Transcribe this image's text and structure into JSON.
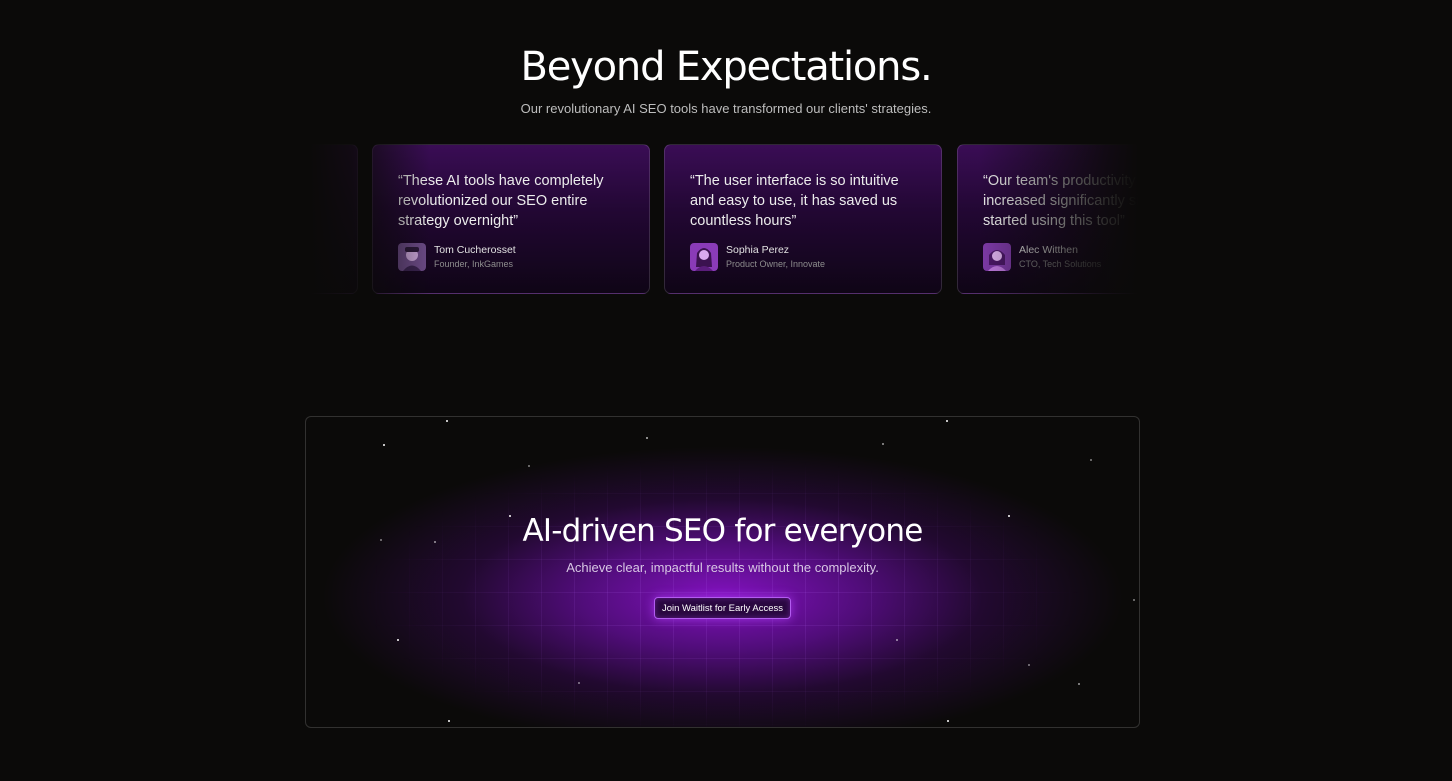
{
  "hero": {
    "title": "Beyond Expectations.",
    "subtitle": "Our revolutionary AI SEO tools have transformed our clients' strategies."
  },
  "testimonials": [
    {
      "quote": "“These AI tools have completely revolutionized our SEO entire strategy overnight”",
      "name": "Tom Cucherosset",
      "role": "Founder, InkGames"
    },
    {
      "quote": "“The user interface is so intuitive and easy to use, it has saved us countless hours”",
      "name": "Sophia Perez",
      "role": "Product Owner, Innovate"
    },
    {
      "quote": "“Our team's productivity has increased significantly since we started using this tool”",
      "name": "Alec Witthen",
      "role": "CTO, Tech Solutions"
    }
  ],
  "cta": {
    "title": "AI-driven SEO for everyone",
    "subtitle": "Achieve clear, impactful results without the complexity.",
    "button_label": "Join Waitlist for Early Access"
  },
  "colors": {
    "background": "#0b0a09",
    "accent": "#8812c8",
    "button_border": "#b25cf0"
  }
}
